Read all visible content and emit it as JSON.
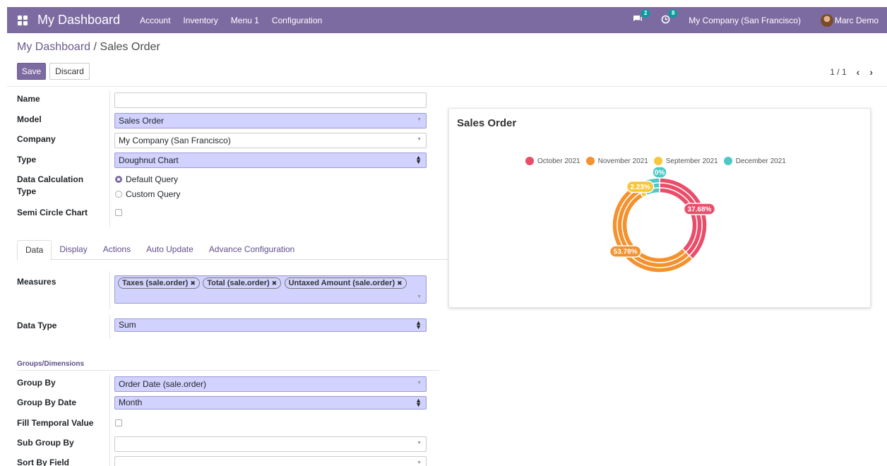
{
  "navbar": {
    "brand": "My Dashboard",
    "menu": [
      "Account",
      "Inventory",
      "Menu 1",
      "Configuration"
    ],
    "messages_count": "2",
    "activities_count": "8",
    "company": "My Company (San Francisco)",
    "user": "Marc Demo"
  },
  "breadcrumb": {
    "parent": "My Dashboard",
    "separator": "/",
    "current": "Sales Order"
  },
  "buttons": {
    "save": "Save",
    "discard": "Discard"
  },
  "pager": {
    "value": "1 / 1"
  },
  "form": {
    "name": {
      "label": "Name",
      "value": ""
    },
    "model": {
      "label": "Model",
      "value": "Sales Order"
    },
    "company": {
      "label": "Company",
      "value": "My Company (San Francisco)"
    },
    "type": {
      "label": "Type",
      "value": "Doughnut Chart"
    },
    "calc_type": {
      "label_line1": "Data Calculation",
      "label_line2": "Type",
      "options": [
        "Default Query",
        "Custom Query"
      ],
      "selected": "Default Query"
    },
    "semi_circle": {
      "label": "Semi Circle Chart",
      "checked": false
    }
  },
  "tabs": [
    "Data",
    "Display",
    "Actions",
    "Auto Update",
    "Advance Configuration"
  ],
  "active_tab": "Data",
  "data_tab": {
    "measures": {
      "label": "Measures",
      "tags": [
        "Taxes (sale.order)",
        "Total (sale.order)",
        "Untaxed Amount (sale.order)"
      ]
    },
    "data_type": {
      "label": "Data Type",
      "value": "Sum"
    },
    "groups_title": "Groups/Dimensions",
    "group_by": {
      "label": "Group By",
      "value": "Order Date (sale.order)"
    },
    "group_by_date": {
      "label": "Group By Date",
      "value": "Month"
    },
    "fill_temporal": {
      "label": "Fill Temporal Value",
      "checked": false
    },
    "sub_group_by": {
      "label": "Sub Group By",
      "value": ""
    },
    "sort_by": {
      "label": "Sort By Field",
      "value": ""
    }
  },
  "chart_title": "Sales Order",
  "chart_data": {
    "type": "doughnut",
    "title": "Sales Order",
    "legend_position": "top",
    "categories": [
      "October 2021",
      "November 2021",
      "September 2021",
      "December 2021"
    ],
    "colors": [
      "#ea4d6a",
      "#f3922f",
      "#f8c63a",
      "#4cc9c6"
    ],
    "rings": 3,
    "series": [
      {
        "values": [
          37.68,
          53.78,
          2.23,
          6.31
        ]
      },
      {
        "values": [
          37.68,
          53.78,
          2.23,
          6.31
        ]
      },
      {
        "values": [
          37.68,
          53.78,
          2.23,
          6.31
        ]
      }
    ],
    "data_labels": [
      "37.68%",
      "53.78%",
      "2.23%",
      "0%"
    ]
  }
}
